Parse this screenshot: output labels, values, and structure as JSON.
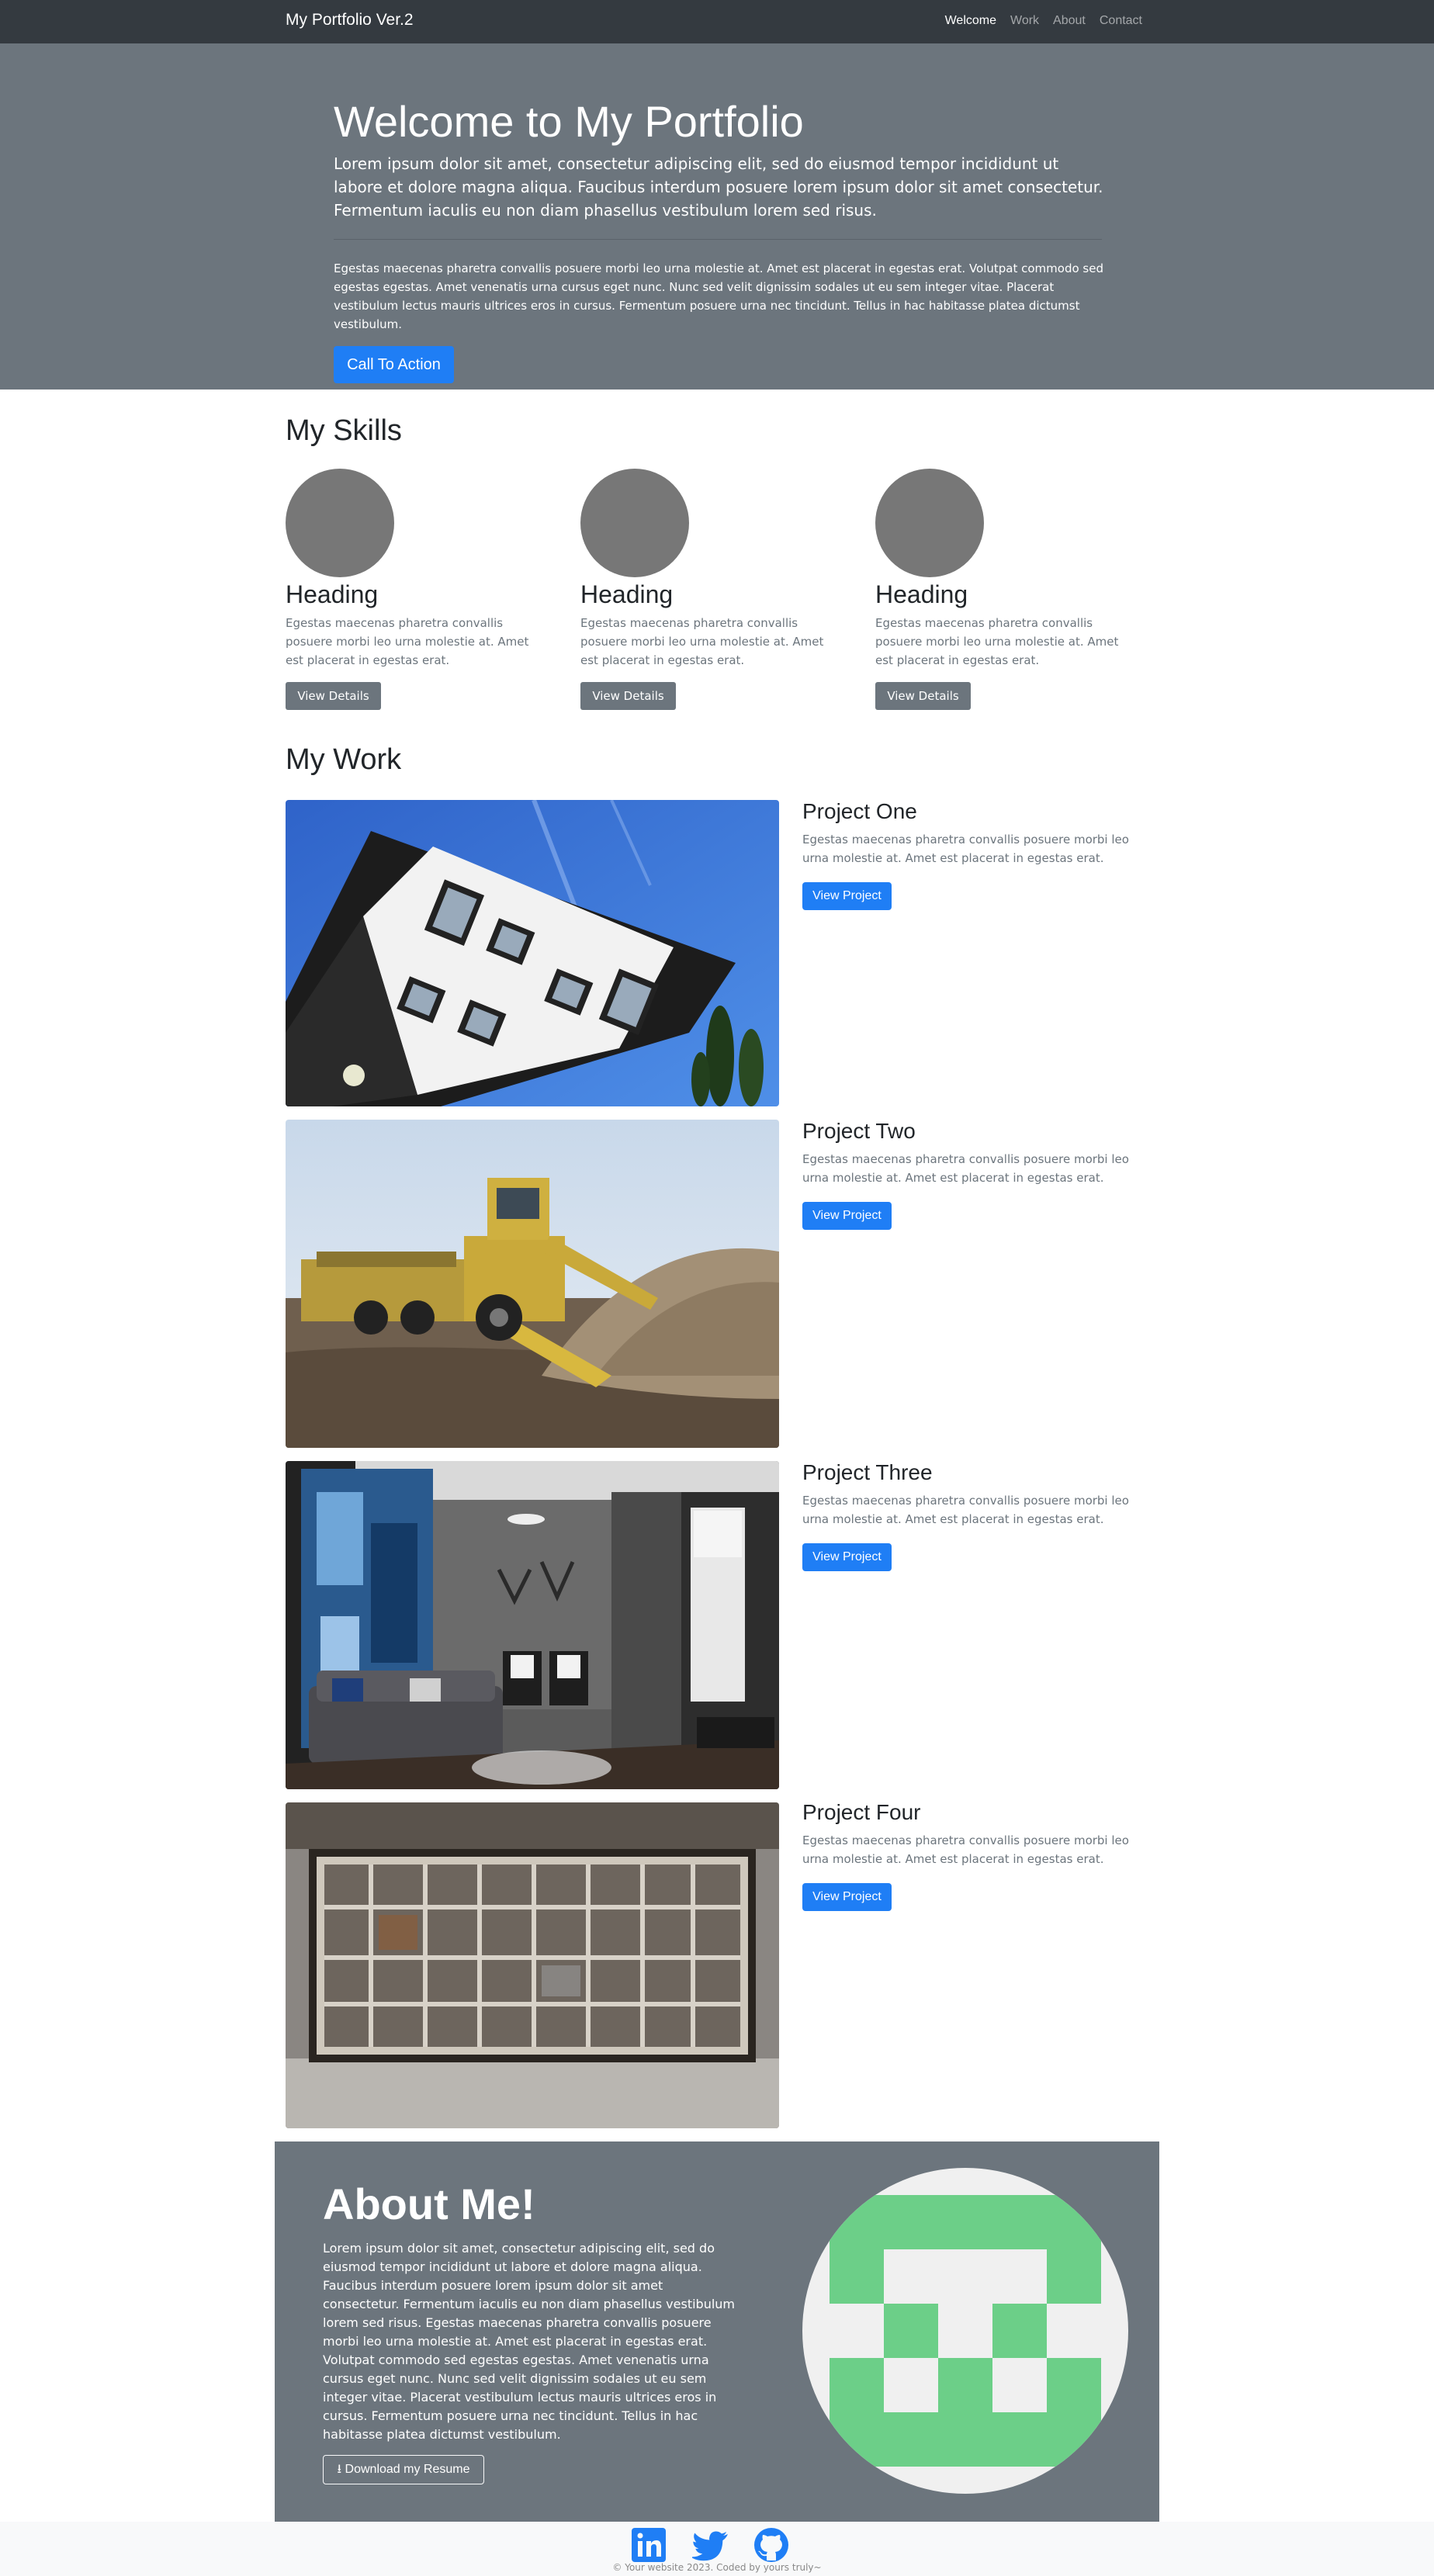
{
  "navbar": {
    "brand": "My Portfolio Ver.2",
    "links": [
      "Welcome",
      "Work",
      "About",
      "Contact"
    ]
  },
  "hero": {
    "title": "Welcome to My Portfolio",
    "lead": "Lorem ipsum dolor sit amet, consectetur adipiscing elit, sed do eiusmod tempor incididunt ut labore et dolore magna aliqua. Faucibus interdum posuere lorem ipsum dolor sit amet consectetur. Fermentum iaculis eu non diam phasellus vestibulum lorem sed risus.",
    "text": "Egestas maecenas pharetra convallis posuere morbi leo urna molestie at. Amet est placerat in egestas erat. Volutpat commodo sed egestas egestas. Amet venenatis urna cursus eget nunc. Nunc sed velit dignissim sodales ut eu sem integer vitae. Placerat vestibulum lectus mauris ultrices eros in cursus. Fermentum posuere urna nec tincidunt. Tellus in hac habitasse platea dictumst vestibulum.",
    "cta": "Call To Action"
  },
  "skills": {
    "title": "My Skills",
    "items": [
      {
        "heading": "Heading",
        "text": "Egestas maecenas pharetra convallis posuere morbi leo urna molestie at. Amet est placerat in egestas erat.",
        "button": "View Details"
      },
      {
        "heading": "Heading",
        "text": "Egestas maecenas pharetra convallis posuere morbi leo urna molestie at. Amet est placerat in egestas erat.",
        "button": "View Details"
      },
      {
        "heading": "Heading",
        "text": "Egestas maecenas pharetra convallis posuere morbi leo urna molestie at. Amet est placerat in egestas erat.",
        "button": "View Details"
      }
    ]
  },
  "work": {
    "title": "My Work",
    "projects": [
      {
        "title": "Project One",
        "text": "Egestas maecenas pharetra convallis posuere morbi leo urna molestie at. Amet est placerat in egestas erat.",
        "button": "View Project"
      },
      {
        "title": "Project Two",
        "text": "Egestas maecenas pharetra convallis posuere morbi leo urna molestie at. Amet est placerat in egestas erat.",
        "button": "View Project"
      },
      {
        "title": "Project Three",
        "text": "Egestas maecenas pharetra convallis posuere morbi leo urna molestie at. Amet est placerat in egestas erat.",
        "button": "View Project"
      },
      {
        "title": "Project Four",
        "text": "Egestas maecenas pharetra convallis posuere morbi leo urna molestie at. Amet est placerat in egestas erat.",
        "button": "View Project"
      }
    ]
  },
  "about": {
    "title": "About Me!",
    "text": "Lorem ipsum dolor sit amet, consectetur adipiscing elit, sed do eiusmod tempor incididunt ut labore et dolore magna aliqua. Faucibus interdum posuere lorem ipsum dolor sit amet consectetur. Fermentum iaculis eu non diam phasellus vestibulum lorem sed risus. Egestas maecenas pharetra convallis posuere morbi leo urna molestie at. Amet est placerat in egestas erat. Volutpat commodo sed egestas egestas. Amet venenatis urna cursus eget nunc. Nunc sed velit dignissim sodales ut eu sem integer vitae. Placerat vestibulum lectus mauris ultrices eros in cursus. Fermentum posuere urna nec tincidunt. Tellus in hac habitasse platea dictumst vestibulum.",
    "resume_button": "Download my Resume"
  },
  "footer": {
    "icons": [
      "linkedin-icon",
      "twitter-icon",
      "github-icon"
    ],
    "copyright": "© Your website 2023. Coded by yours truly~"
  },
  "colors": {
    "navbar": "#343a40",
    "hero": "#6c757d",
    "primary": "#1f7ef5",
    "secondary": "#6c757d",
    "social": "#1f7ef5",
    "identicon": "#6ccf88"
  }
}
